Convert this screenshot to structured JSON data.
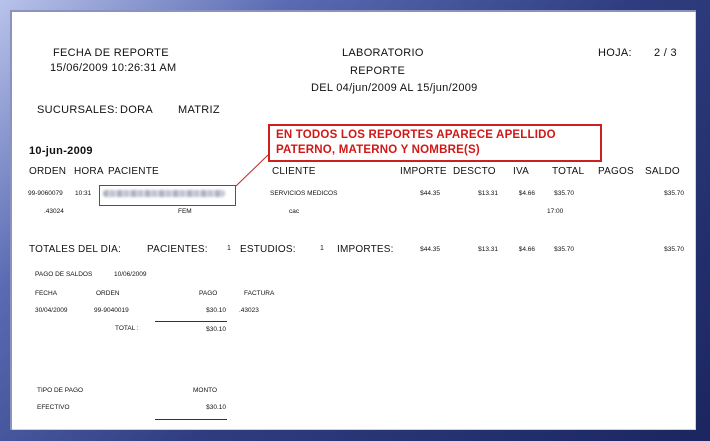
{
  "colors": {
    "frame": "#2f3d80",
    "callout": "#cc2020"
  },
  "header": {
    "fecha_label": "FECHA DE REPORTE",
    "fecha_value": "15/06/2009 10:26:31 AM",
    "lab": "LABORATORIO",
    "reporte": "REPORTE",
    "periodo": "DEL 04/jun/2009 AL 15/jun/2009",
    "hoja_label": "HOJA:",
    "hoja_value": "2 / 3"
  },
  "sucursales": {
    "label": "SUCURSALES:",
    "name": "DORA",
    "matriz": "MATRIZ"
  },
  "day": "10-jun-2009",
  "callout": {
    "line1": "EN TODOS LOS REPORTES APARECE APELLIDO",
    "line2": "PATERNO, MATERNO Y  NOMBRE(S)"
  },
  "columns": [
    "ORDEN",
    "HORA",
    "PACIENTE",
    "CLIENTE",
    "IMPORTE",
    "DESCTO",
    "IVA",
    "TOTAL",
    "PAGOS",
    "SALDO"
  ],
  "row": {
    "orden": "99-9060079",
    "hora": "10:31",
    "cliente": "SERVICIOS MEDICOS",
    "importe": "$44.35",
    "descto": "$13.31",
    "iva": "$4.66",
    "total": "$35.70",
    "saldo": "$35.70",
    "sub_id": ".43024",
    "sexo": "FEM",
    "sub_cliente": "cac",
    "hora_entrega": "17:00"
  },
  "totales": {
    "label": "TOTALES DEL DIA:",
    "pacientes_label": "PACIENTES:",
    "pacientes": "1",
    "estudios_label": "ESTUDIOS:",
    "estudios": "1",
    "importes_label": "IMPORTES:",
    "importe": "$44.35",
    "descto": "$13.31",
    "iva": "$4.66",
    "total": "$35.70",
    "saldo": "$35.70"
  },
  "pago_saldos": {
    "title": "PAGO DE SALDOS",
    "date": "10/06/2009",
    "headers": {
      "fecha": "FECHA",
      "orden": "ORDEN",
      "pago": "PAGO",
      "factura": "FACTURA"
    },
    "row": {
      "fecha": "30/04/2009",
      "orden": "99-9040019",
      "pago": "$30.10",
      "factura": ".43023"
    },
    "total_label": "TOTAL :",
    "total": "$30.10"
  },
  "tipo_pago": {
    "header": "TIPO DE PAGO",
    "monto_label": "MONTO",
    "efectivo": "EFECTIVO",
    "efectivo_monto": "$30.10"
  }
}
